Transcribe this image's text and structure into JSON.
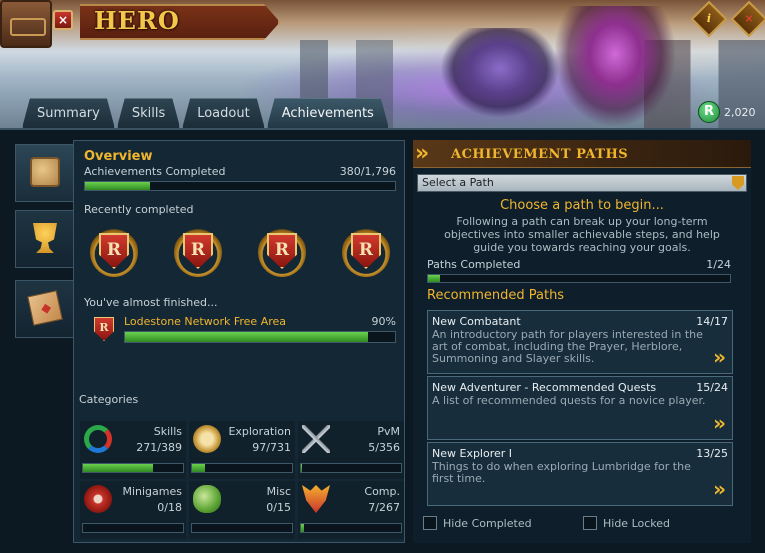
{
  "app": {
    "title": "HERO",
    "close_glyph": "×",
    "info_glyph": "i",
    "corner_close_glyph": "×"
  },
  "tabs": [
    {
      "label": "Summary",
      "active": false
    },
    {
      "label": "Skills",
      "active": false
    },
    {
      "label": "Loadout",
      "active": false
    },
    {
      "label": "Achievements",
      "active": true
    }
  ],
  "runecoins": {
    "icon_letter": "R",
    "count": "2,020"
  },
  "side_tabs": [
    {
      "name": "overview-scroll-icon"
    },
    {
      "name": "trophy-icon"
    },
    {
      "name": "map-icon"
    }
  ],
  "overview": {
    "title": "Overview",
    "achievements_label": "Achievements Completed",
    "achievements_count": "380/1,796",
    "achievements_progress": 0.21,
    "recently_completed_label": "Recently completed",
    "recent_badges": [
      "R",
      "R",
      "R",
      "R"
    ],
    "almost_label": "You've almost finished...",
    "almost_item": {
      "badge": "R",
      "name": "Lodestone Network Free Area",
      "percent_text": "90%",
      "progress": 0.9
    },
    "categories_label": "Categories",
    "categories": [
      {
        "name": "Skills",
        "value": "271/389",
        "progress": 0.7,
        "icon": "skills-ring-icon"
      },
      {
        "name": "Exploration",
        "value": "97/731",
        "progress": 0.13,
        "icon": "compass-icon"
      },
      {
        "name": "PvM",
        "value": "5/356",
        "progress": 0.014,
        "icon": "crossed-swords-icon"
      },
      {
        "name": "Minigames",
        "value": "0/18",
        "progress": 0,
        "icon": "minigames-icon"
      },
      {
        "name": "Misc",
        "value": "0/15",
        "progress": 0,
        "icon": "cabbage-icon"
      },
      {
        "name": "Comp.",
        "value": "7/267",
        "progress": 0.026,
        "icon": "completionist-cape-icon"
      }
    ]
  },
  "paths": {
    "header": "ACHIEVEMENT PATHS",
    "select_value": "Select a Path",
    "choose_title": "Choose a path to begin...",
    "choose_desc": "Following a path can break up your long-term objectives into smaller achievable steps, and help guide you towards reaching your goals.",
    "completed_label": "Paths Completed",
    "completed_count": "1/24",
    "completed_progress": 0.04,
    "recommended_title": "Recommended Paths",
    "recommended": [
      {
        "name": "New Combatant",
        "count": "14/17",
        "desc": "An introductory path for players interested in the art of combat, including the Prayer, Herblore, Summoning and Slayer skills."
      },
      {
        "name": "New Adventurer - Recommended Quests",
        "count": "15/24",
        "desc": "A list of recommended quests for a novice player."
      },
      {
        "name": "New Explorer I",
        "count": "13/25",
        "desc": "Things to do when exploring Lumbridge for the first time."
      }
    ],
    "arrow_glyph": "»",
    "hide_completed_label": "Hide Completed",
    "hide_locked_label": "Hide Locked"
  },
  "colors": {
    "gold": "#f0b62e",
    "progress_green": "#4cba38",
    "panel": "#142734"
  }
}
